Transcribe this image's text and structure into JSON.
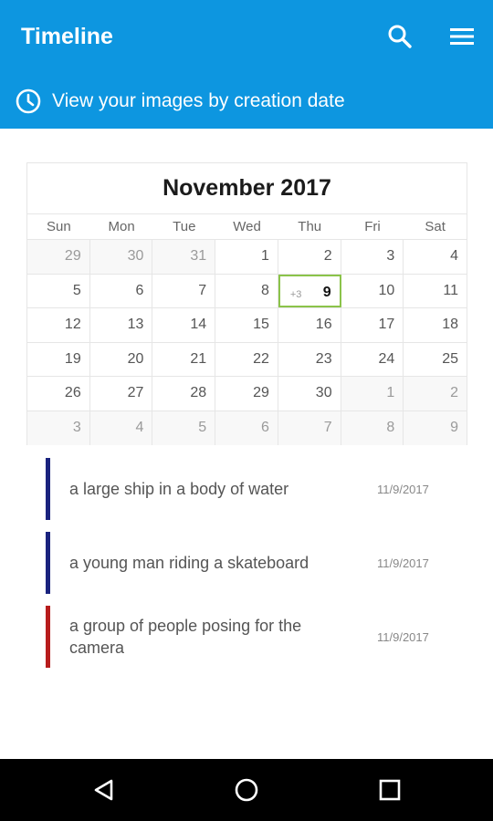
{
  "appbar": {
    "title": "Timeline",
    "subtitle": "View your images by creation date",
    "search_icon": "search-icon",
    "menu_icon": "menu-icon",
    "clock_icon": "clock-icon",
    "color": "#0d96e0"
  },
  "calendar": {
    "month_label": "November 2017",
    "weekdays": [
      "Sun",
      "Mon",
      "Tue",
      "Wed",
      "Thu",
      "Fri",
      "Sat"
    ],
    "weeks": [
      [
        {
          "d": "29",
          "other": true
        },
        {
          "d": "30",
          "other": true
        },
        {
          "d": "31",
          "other": true
        },
        {
          "d": "1"
        },
        {
          "d": "2"
        },
        {
          "d": "3"
        },
        {
          "d": "4"
        }
      ],
      [
        {
          "d": "5"
        },
        {
          "d": "6"
        },
        {
          "d": "7"
        },
        {
          "d": "8"
        },
        {
          "d": "9",
          "today": true,
          "count": "+3"
        },
        {
          "d": "10"
        },
        {
          "d": "11"
        }
      ],
      [
        {
          "d": "12"
        },
        {
          "d": "13"
        },
        {
          "d": "14"
        },
        {
          "d": "15"
        },
        {
          "d": "16"
        },
        {
          "d": "17"
        },
        {
          "d": "18"
        }
      ],
      [
        {
          "d": "19"
        },
        {
          "d": "20"
        },
        {
          "d": "21"
        },
        {
          "d": "22"
        },
        {
          "d": "23"
        },
        {
          "d": "24"
        },
        {
          "d": "25"
        }
      ],
      [
        {
          "d": "26"
        },
        {
          "d": "27"
        },
        {
          "d": "28"
        },
        {
          "d": "29"
        },
        {
          "d": "30"
        },
        {
          "d": "1",
          "other": true
        },
        {
          "d": "2",
          "other": true
        }
      ],
      [
        {
          "d": "3",
          "other": true
        },
        {
          "d": "4",
          "other": true
        },
        {
          "d": "5",
          "other": true
        },
        {
          "d": "6",
          "other": true
        },
        {
          "d": "7",
          "other": true
        },
        {
          "d": "8",
          "other": true
        },
        {
          "d": "9",
          "other": true
        }
      ]
    ],
    "today_color": "#8bc34a"
  },
  "images": [
    {
      "caption": "a large ship in a body of water",
      "date": "11/9/2017",
      "color": "#1a237e"
    },
    {
      "caption": "a young man riding a skateboard",
      "date": "11/9/2017",
      "color": "#1a237e"
    },
    {
      "caption": "a group of people posing for the camera",
      "date": "11/9/2017",
      "color": "#b71c1c"
    }
  ],
  "navbar": {
    "back_icon": "back-icon",
    "home_icon": "home-icon",
    "recent_icon": "recent-apps-icon"
  }
}
